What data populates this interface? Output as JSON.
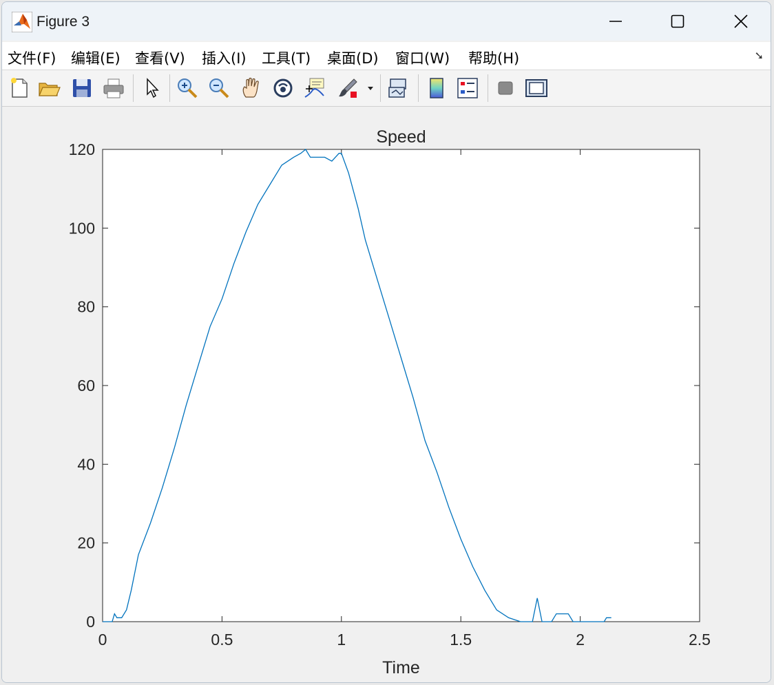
{
  "window": {
    "title": "Figure 3",
    "minimize_label": "",
    "maximize_label": "",
    "close_label": ""
  },
  "menu": {
    "items": [
      {
        "label": "文件(F)"
      },
      {
        "label": "编辑(E)"
      },
      {
        "label": "查看(V)"
      },
      {
        "label": "插入(I)"
      },
      {
        "label": "工具(T)"
      },
      {
        "label": "桌面(D)"
      },
      {
        "label": "窗口(W)"
      },
      {
        "label": "帮助(H)"
      }
    ]
  },
  "toolbar": {
    "icons": [
      "new-figure-icon",
      "open-file-icon",
      "save-icon",
      "print-icon",
      "select-arrow-icon",
      "zoom-in-icon",
      "zoom-out-icon",
      "pan-hand-icon",
      "rotate-3d-icon",
      "data-tips-icon",
      "brush-icon",
      "brush-dropdown-icon",
      "link-plot-icon",
      "colorbar-icon",
      "legend-icon",
      "hide-plot-tools-icon",
      "show-plot-tools-icon"
    ]
  },
  "colors": {
    "line": "#0072BD",
    "axes_bg": "#ffffff",
    "figure_bg": "#f0f0f0",
    "text": "#262626"
  },
  "chart_data": {
    "type": "line",
    "title": "Speed",
    "xlabel": "Time",
    "ylabel": "",
    "xlim": [
      0,
      2.5
    ],
    "ylim": [
      0,
      120
    ],
    "xticks": [
      "0",
      "0.5",
      "1",
      "1.5",
      "2",
      "2.5"
    ],
    "yticks": [
      "0",
      "20",
      "40",
      "60",
      "80",
      "100",
      "120"
    ],
    "grid": false,
    "series": [
      {
        "x": [
          0,
          0.04,
          0.05,
          0.06,
          0.07,
          0.08,
          0.1,
          0.12,
          0.15,
          0.2,
          0.25,
          0.3,
          0.35,
          0.4,
          0.45,
          0.5,
          0.55,
          0.6,
          0.65,
          0.7,
          0.75,
          0.8,
          0.83,
          0.85,
          0.87,
          0.9,
          0.93,
          0.96,
          0.99,
          1.0,
          1.03,
          1.07,
          1.1,
          1.15,
          1.2,
          1.25,
          1.3,
          1.35,
          1.4,
          1.45,
          1.5,
          1.55,
          1.6,
          1.65,
          1.7,
          1.75,
          1.8,
          1.82,
          1.84,
          1.88,
          1.9,
          1.95,
          1.97,
          2.0,
          2.05,
          2.1,
          2.11,
          2.13
        ],
        "y": [
          0,
          0,
          2,
          1,
          1,
          1,
          3,
          8,
          17,
          25,
          34,
          44,
          55,
          65,
          75,
          82,
          91,
          99,
          106,
          111,
          116,
          118,
          119,
          120,
          118,
          118,
          118,
          117,
          119,
          119,
          114,
          105,
          97,
          87,
          77,
          67,
          57,
          46,
          38,
          29,
          21,
          14,
          8,
          3,
          1,
          0,
          0,
          6,
          0,
          0,
          2,
          2,
          0,
          0,
          0,
          0,
          1,
          1
        ]
      }
    ]
  }
}
